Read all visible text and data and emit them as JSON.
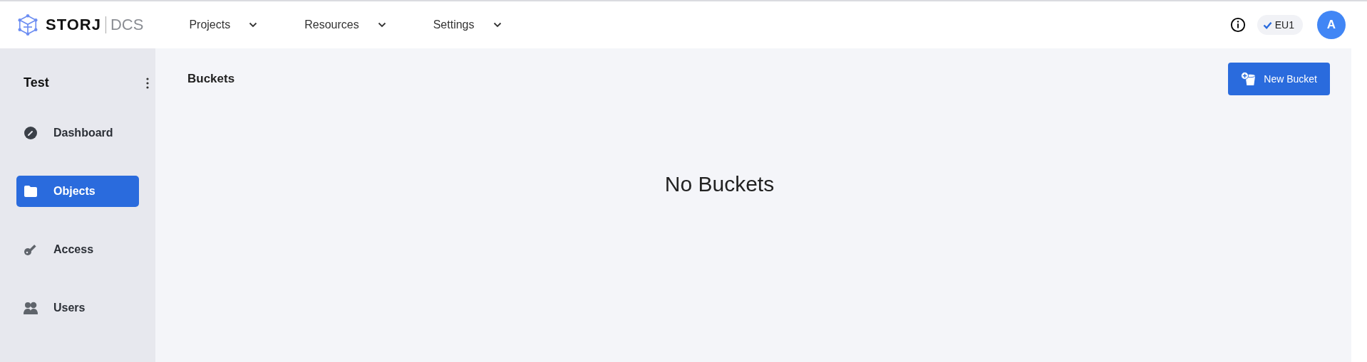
{
  "header": {
    "logo": {
      "brand": "STORJ",
      "product": "DCS"
    },
    "nav": [
      {
        "label": "Projects"
      },
      {
        "label": "Resources"
      },
      {
        "label": "Settings"
      }
    ],
    "region": {
      "label": "EU1",
      "checked": true
    },
    "avatar": "A"
  },
  "sidebar": {
    "project": "Test",
    "items": [
      {
        "label": "Dashboard",
        "selected": false
      },
      {
        "label": "Objects",
        "selected": true
      },
      {
        "label": "Access",
        "selected": false
      },
      {
        "label": "Users",
        "selected": false
      }
    ]
  },
  "main": {
    "title": "Buckets",
    "new_button": "New Bucket",
    "empty_text": "No Buckets"
  }
}
